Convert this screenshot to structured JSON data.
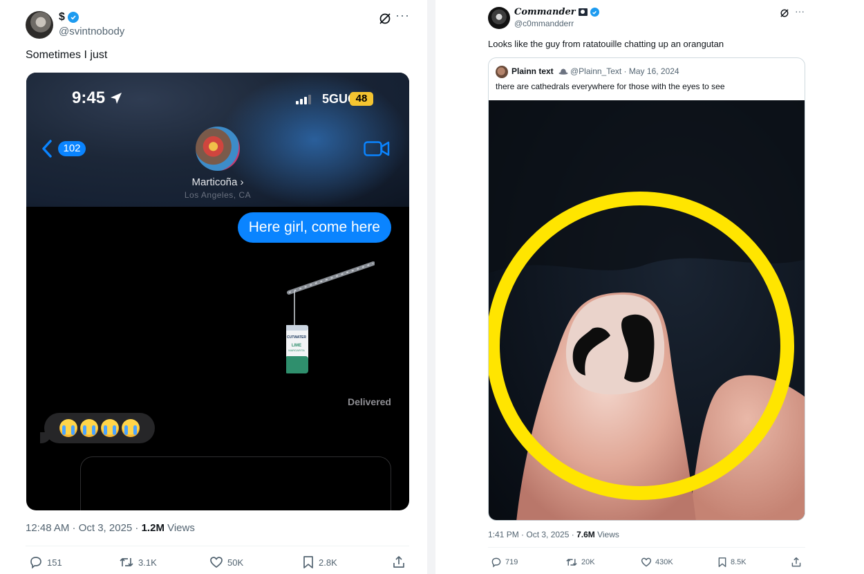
{
  "left_tweet": {
    "display_name": "$",
    "handle": "@svintnobody",
    "text": "Sometimes I just",
    "timestamp": "12:48 AM · Oct 3, 2025 · ",
    "views_count": "1.2M",
    "views_label": " Views",
    "actions": {
      "replies": "151",
      "reposts": "3.1K",
      "likes": "50K",
      "bookmarks": "2.8K"
    },
    "screenshot": {
      "time": "9:45",
      "network": "5GUC",
      "battery": "48",
      "back_count": "102",
      "contact_name": "Marticoña ›",
      "contact_location": "Los Angeles, CA",
      "sent_message": "Here girl, come here",
      "status": "Delivered",
      "can_label": "CUTWATER LIME MARGARITA"
    }
  },
  "right_tweet": {
    "display_name": "Commander",
    "handle": "@c0mmandderr",
    "text": "Looks like the guy from ratatouille chatting up an orangutan",
    "timestamp": "1:41 PM · Oct 3, 2025 · ",
    "views_count": "7.6M",
    "views_label": " Views",
    "actions": {
      "replies": "719",
      "reposts": "20K",
      "likes": "430K",
      "bookmarks": "8.5K"
    },
    "quoted": {
      "display_name": "Plainn text",
      "handle_date": "@Plainn_Text · May 16, 2024",
      "text": "there are cathedrals everywhere for those with the eyes to see"
    }
  },
  "colors": {
    "verified": "#1d9bf0",
    "imessage_blue": "#0a84ff",
    "highlight_circle": "#ffe500",
    "secondary_text": "#536471"
  }
}
